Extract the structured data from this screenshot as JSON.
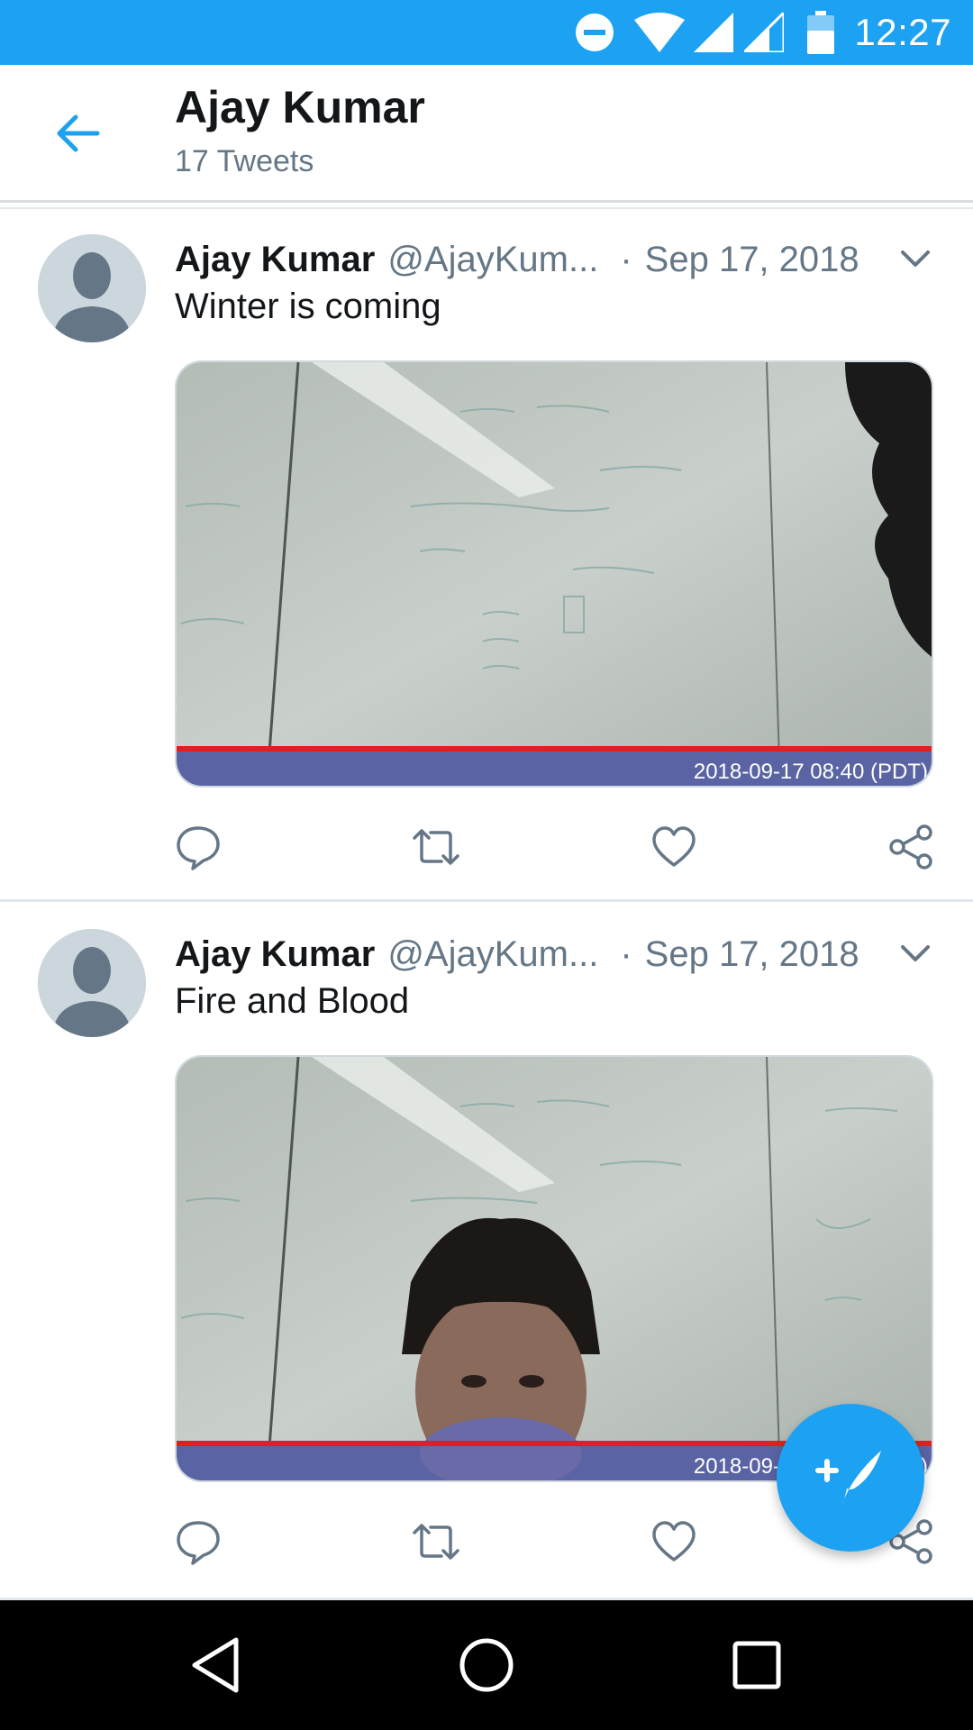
{
  "status_bar": {
    "time": "12:27",
    "icons": [
      "do-not-disturb-icon",
      "wifi-icon",
      "signal-icon",
      "signal-icon",
      "battery-icon"
    ]
  },
  "header": {
    "title": "Ajay Kumar",
    "subtitle": "17 Tweets"
  },
  "tweets": [
    {
      "name": "Ajay Kumar",
      "handle": "@AjayKum...",
      "separator": "·",
      "date": "Sep 17, 2018",
      "text": "Winter is coming",
      "media_timestamp": "2018-09-17 08:40 (PDT)"
    },
    {
      "name": "Ajay Kumar",
      "handle": "@AjayKum...",
      "separator": "·",
      "date": "Sep 17, 2018",
      "text": "Fire and Blood",
      "media_timestamp": "2018-09-17 08:40 (PDT)"
    }
  ],
  "actions": [
    "reply-icon",
    "retweet-icon",
    "like-icon",
    "share-icon"
  ],
  "fab": {
    "icon": "compose-tweet-icon"
  },
  "nav_bar": {
    "buttons": [
      "back",
      "home",
      "recents"
    ]
  },
  "colors": {
    "accent": "#1da1f2",
    "text_primary": "#14171a",
    "text_secondary": "#657786",
    "divider": "#e1e8ed"
  }
}
